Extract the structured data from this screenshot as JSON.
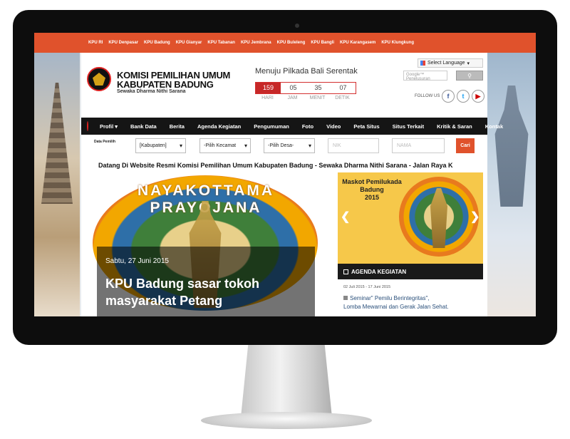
{
  "topbar": {
    "links": [
      "KPU RI",
      "KPU Denpasar",
      "KPU Badung",
      "KPU Gianyar",
      "KPU Tabanan",
      "KPU Jembrana",
      "KPU Buleleng",
      "KPU Bangli",
      "KPU Karangasem",
      "KPU Klungkung"
    ]
  },
  "header": {
    "org_line1": "KOMISI PEMILIHAN UMUM",
    "org_line2": "KABUPATEN BADUNG",
    "tagline": "Sewaka Dharma Nithi Sarana"
  },
  "countdown": {
    "title": "Menuju Pilkada Bali Serentak",
    "values": [
      "159",
      "05",
      "35",
      "07"
    ],
    "labels": [
      "HARI",
      "JAM",
      "MENIT",
      "DETIK"
    ]
  },
  "language": {
    "label": "Select Language"
  },
  "search": {
    "placeholder": "Google™ Penelusuran"
  },
  "social": {
    "follow_label": "FOLLOW US",
    "fb": "f",
    "tw": "t",
    "yt": "▶"
  },
  "nav": {
    "items": [
      "Profil ▾",
      "Bank Data",
      "Berita",
      "Agenda Kegiatan",
      "Pengumuman",
      "Foto",
      "Video",
      "Peta Situs",
      "Situs Terkait",
      "Kritik & Saran",
      "Kontak"
    ]
  },
  "filters": {
    "label": "Data Pemilih",
    "kabupaten": "[Kabupaten]",
    "kecamatan": "-Pilih Kecamat",
    "desa": "-Pilih Desa-",
    "nik_placeholder": "NIK",
    "nama_placeholder": "NAMA",
    "cari": "Cari"
  },
  "marquee": "Datang Di Website Resmi Komisi Pemilihan Umum Kabupaten Badung - Sewaka Dharma Nithi Sarana - Jalan Raya K",
  "hero": {
    "emblem_text": "NAYAKOTTAMA PRAYOJANA",
    "date": "Sabtu, 27 Juni 2015",
    "title_line1": "KPU Badung sasar tokoh",
    "title_line2": "masyarakat Petang"
  },
  "mascot": {
    "line1": "Maskot Pemilukada",
    "line2": "Badung",
    "line3": "2015",
    "prev": "❮",
    "next": "❯"
  },
  "agenda": {
    "title": "AGENDA KEGIATAN",
    "date": "02 Juli 2015 - 17 Juni 2015",
    "item_line1": "Seminar\" Pemilu Berintegritas\",",
    "item_line2": "Lomba Mewarnai dan Gerak Jalan Sehat."
  }
}
